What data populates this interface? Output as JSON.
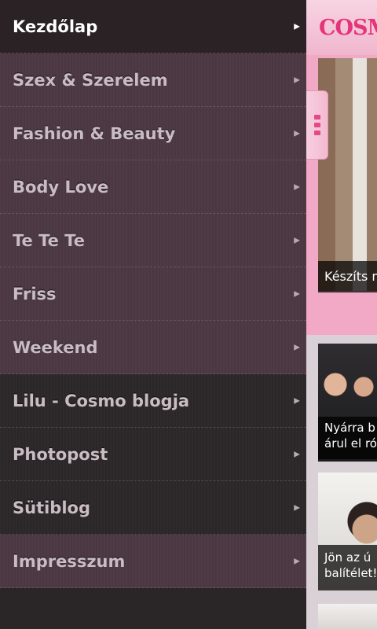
{
  "menu": {
    "items": [
      {
        "label": "Kezdőlap"
      },
      {
        "label": "Szex & Szerelem"
      },
      {
        "label": "Fashion & Beauty"
      },
      {
        "label": "Body Love"
      },
      {
        "label": "Te Te Te"
      },
      {
        "label": "Friss"
      },
      {
        "label": "Weekend"
      },
      {
        "label": "Lilu - Cosmo blogja"
      },
      {
        "label": "Photopost"
      },
      {
        "label": "Sütiblog"
      },
      {
        "label": "Impresszum"
      }
    ],
    "arrow": "▶"
  },
  "content": {
    "logo": "COSMOPO",
    "hero_caption": "Készíts m",
    "cards": [
      {
        "caption_line1": "Nyárra b",
        "caption_line2": "árul el ró"
      },
      {
        "caption_line1": "Jön az ú",
        "caption_line2": "balítélet!"
      }
    ]
  },
  "colors": {
    "accent_pink": "#e6347a",
    "drawer_bg": "#2a2527"
  }
}
